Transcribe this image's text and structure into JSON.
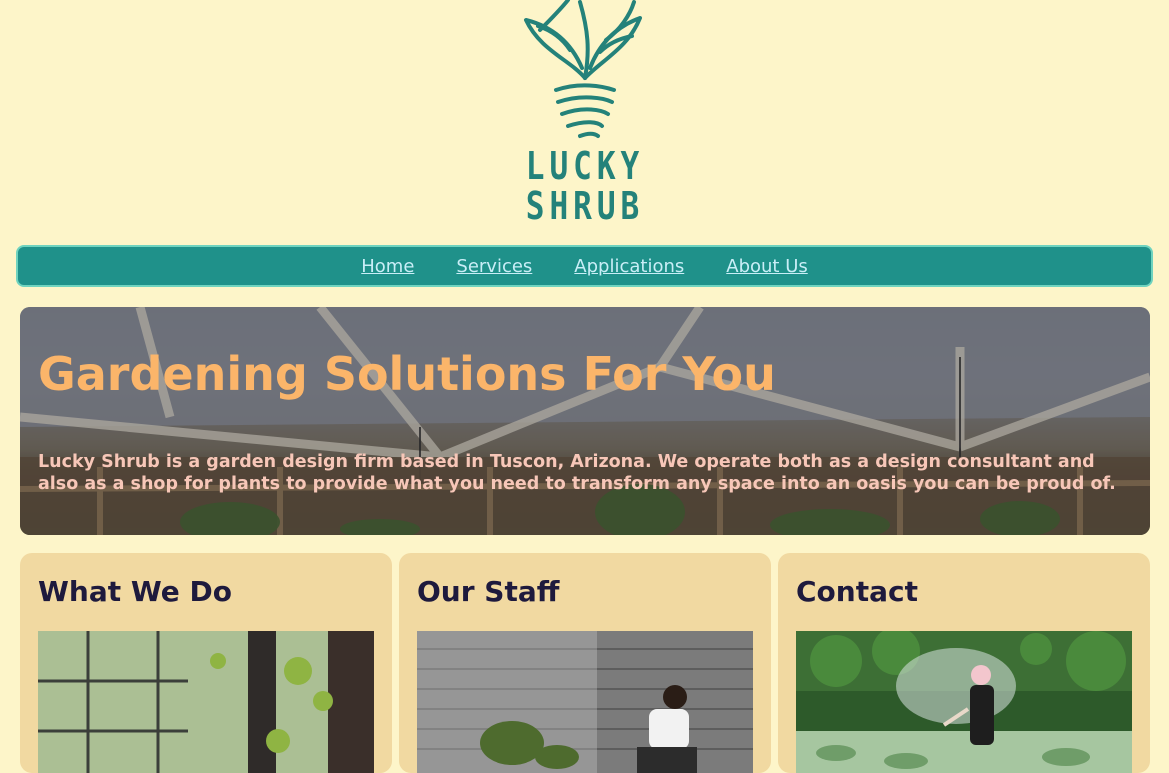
{
  "brand": {
    "logo_line1": "LUCKY",
    "logo_line2": "SHRUB",
    "color": "#24827a"
  },
  "nav": {
    "items": [
      {
        "label": "Home"
      },
      {
        "label": "Services"
      },
      {
        "label": "Applications"
      },
      {
        "label": "About Us"
      }
    ]
  },
  "hero": {
    "title": "Gardening Solutions For You",
    "text": "Lucky Shrub is a garden design firm based in Tuscon, Arizona. We operate both as a design consultant and also as a shop for plants to provide what you need to transform any space into an oasis you can be proud of."
  },
  "cards": [
    {
      "title": "What We Do"
    },
    {
      "title": "Our Staff"
    },
    {
      "title": "Contact"
    }
  ],
  "colors": {
    "background": "#fdf5c9",
    "nav": "#1f918a",
    "nav_link": "#c9eef7",
    "hero_title": "#fbb56a",
    "hero_text": "#f7c7b8",
    "card": "#f1d9a1",
    "card_title": "#1e1a3d"
  }
}
